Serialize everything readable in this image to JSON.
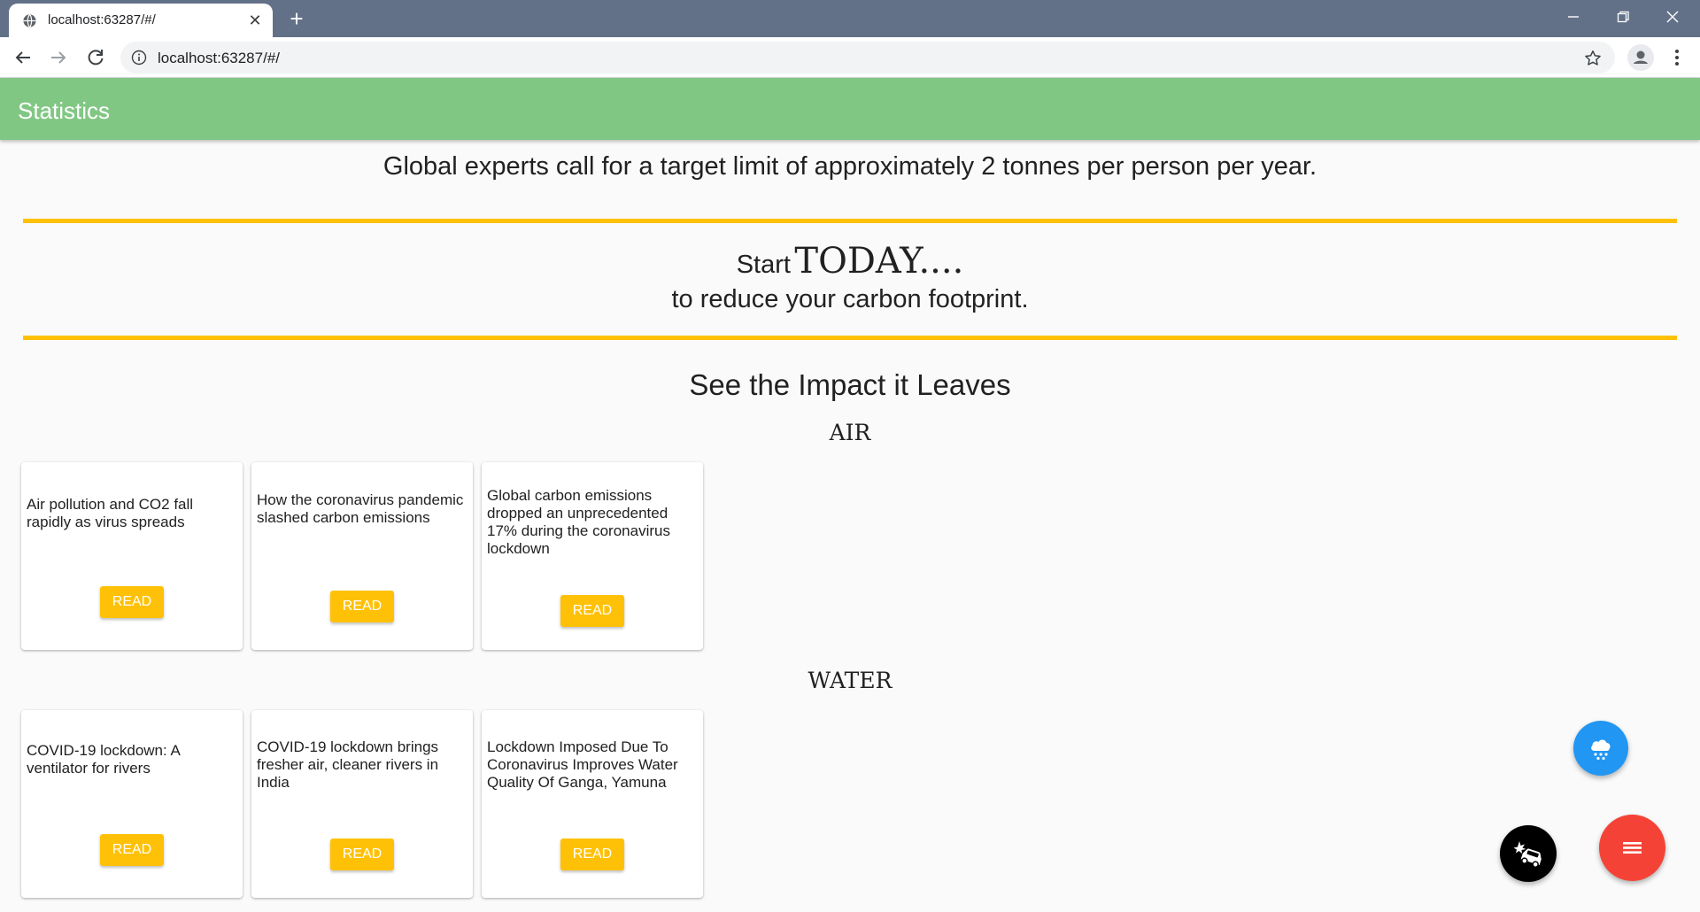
{
  "browser": {
    "tab_title": "localhost:63287/#/",
    "url": "localhost:63287/#/",
    "new_tab": "+",
    "close_tab": "✕"
  },
  "app": {
    "title": "Statistics",
    "accent_color": "#81c784",
    "highlight_color": "#ffc107"
  },
  "content": {
    "headline": "Global experts call for a target limit of approximately 2 tonnes per person per year.",
    "start_word": "Start",
    "today_word": "TODAY....",
    "reduce_text": "to reduce your carbon footprint.",
    "impact_heading": "See the Impact it Leaves"
  },
  "sections": [
    {
      "label": "AIR",
      "cards": [
        {
          "text": "Air pollution and CO2 fall rapidly as virus spreads",
          "button": "READ"
        },
        {
          "text": "How the coronavirus pandemic slashed carbon emissions",
          "button": "READ"
        },
        {
          "text": "Global carbon emissions dropped an unprecedented 17% during the coronavirus lockdown",
          "button": "READ"
        }
      ]
    },
    {
      "label": "WATER",
      "cards": [
        {
          "text": "COVID-19 lockdown: A ventilator for rivers",
          "button": "READ"
        },
        {
          "text": "COVID-19 lockdown brings fresher air, cleaner rivers in India",
          "button": "READ"
        },
        {
          "text": "Lockdown Imposed Due To Coronavirus Improves Water Quality Of Ganga, Yamuna",
          "button": "READ"
        }
      ]
    }
  ],
  "fabs": {
    "rain_icon": "cloud-rain-icon",
    "car_icon": "car-crash-icon",
    "menu_icon": "menu-icon"
  }
}
